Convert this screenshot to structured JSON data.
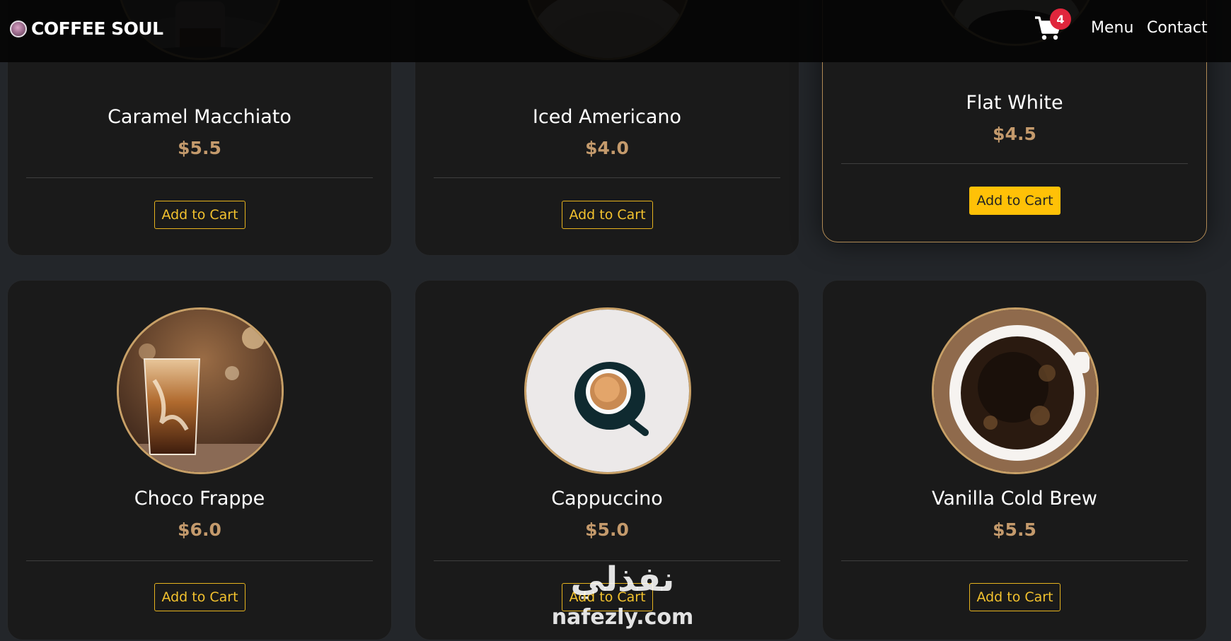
{
  "brand": {
    "name": "COFFEE SOUL",
    "logo_icon": "coffee-cup-icon"
  },
  "nav": {
    "cart_icon": "cart-icon",
    "cart_count": "4",
    "links": [
      "Menu",
      "Contact"
    ]
  },
  "products": [
    {
      "name": "Caramel Macchiato",
      "price": "$5.5",
      "button": "Add to Cart"
    },
    {
      "name": "Iced Americano",
      "price": "$4.0",
      "button": "Add to Cart"
    },
    {
      "name": "Flat White",
      "price": "$4.5",
      "button": "Add to Cart"
    },
    {
      "name": "Choco Frappe",
      "price": "$6.0",
      "button": "Add to Cart"
    },
    {
      "name": "Cappuccino",
      "price": "$5.0",
      "button": "Add to Cart"
    },
    {
      "name": "Vanilla Cold Brew",
      "price": "$5.5",
      "button": "Add to Cart"
    }
  ],
  "watermark": {
    "arabic": "نفذلي",
    "latin": "nafezly.com"
  },
  "colors": {
    "accent": "#ffc107",
    "price": "#c49a6c",
    "badge": "#e0263c",
    "card_bg": "#1a1a1a"
  }
}
